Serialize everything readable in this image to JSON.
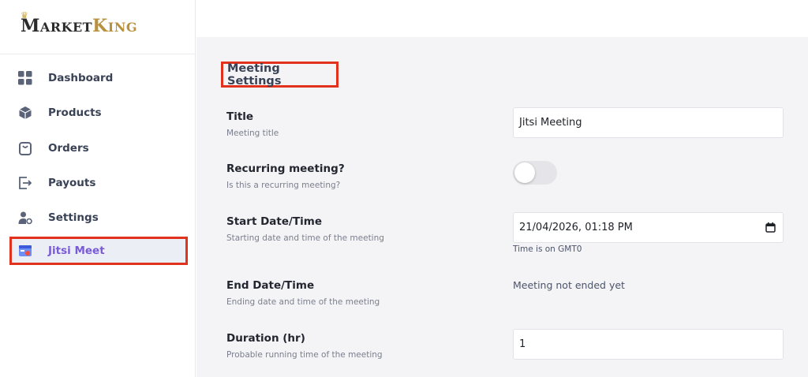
{
  "brand": {
    "logo_first_initial": "M",
    "logo_first_rest": "ARKET",
    "logo_second_initial": "K",
    "logo_second_rest": "ING",
    "logo_accent_color": "#b8923e"
  },
  "sidebar": {
    "items": [
      {
        "label": "Dashboard",
        "icon": "dashboard-grid-icon"
      },
      {
        "label": "Products",
        "icon": "box-icon"
      },
      {
        "label": "Orders",
        "icon": "shopping-bag-icon"
      },
      {
        "label": "Payouts",
        "icon": "payout-export-icon"
      },
      {
        "label": "Settings",
        "icon": "user-settings-icon"
      },
      {
        "label": "Jitsi Meet",
        "icon": "jitsi-video-icon",
        "active": true
      }
    ],
    "active_color": "#7a5bd6",
    "highlight_color": "#e0321c"
  },
  "main": {
    "section_title": "Meeting Settings",
    "fields": {
      "title": {
        "label": "Title",
        "description": "Meeting title",
        "value": "Jitsi Meeting"
      },
      "recurring": {
        "label": "Recurring meeting?",
        "description": "Is this a recurring meeting?",
        "enabled": false
      },
      "start": {
        "label": "Start Date/Time",
        "description": "Starting date and time of the meeting",
        "value": "21/04/2026, 01:18 PM",
        "timezone_note": "Time is on GMT0"
      },
      "end": {
        "label": "End Date/Time",
        "description": "Ending date and time of the meeting",
        "value": "Meeting not ended yet"
      },
      "duration": {
        "label": "Duration (hr)",
        "description": "Probable running time of the meeting",
        "value": "1"
      }
    }
  }
}
